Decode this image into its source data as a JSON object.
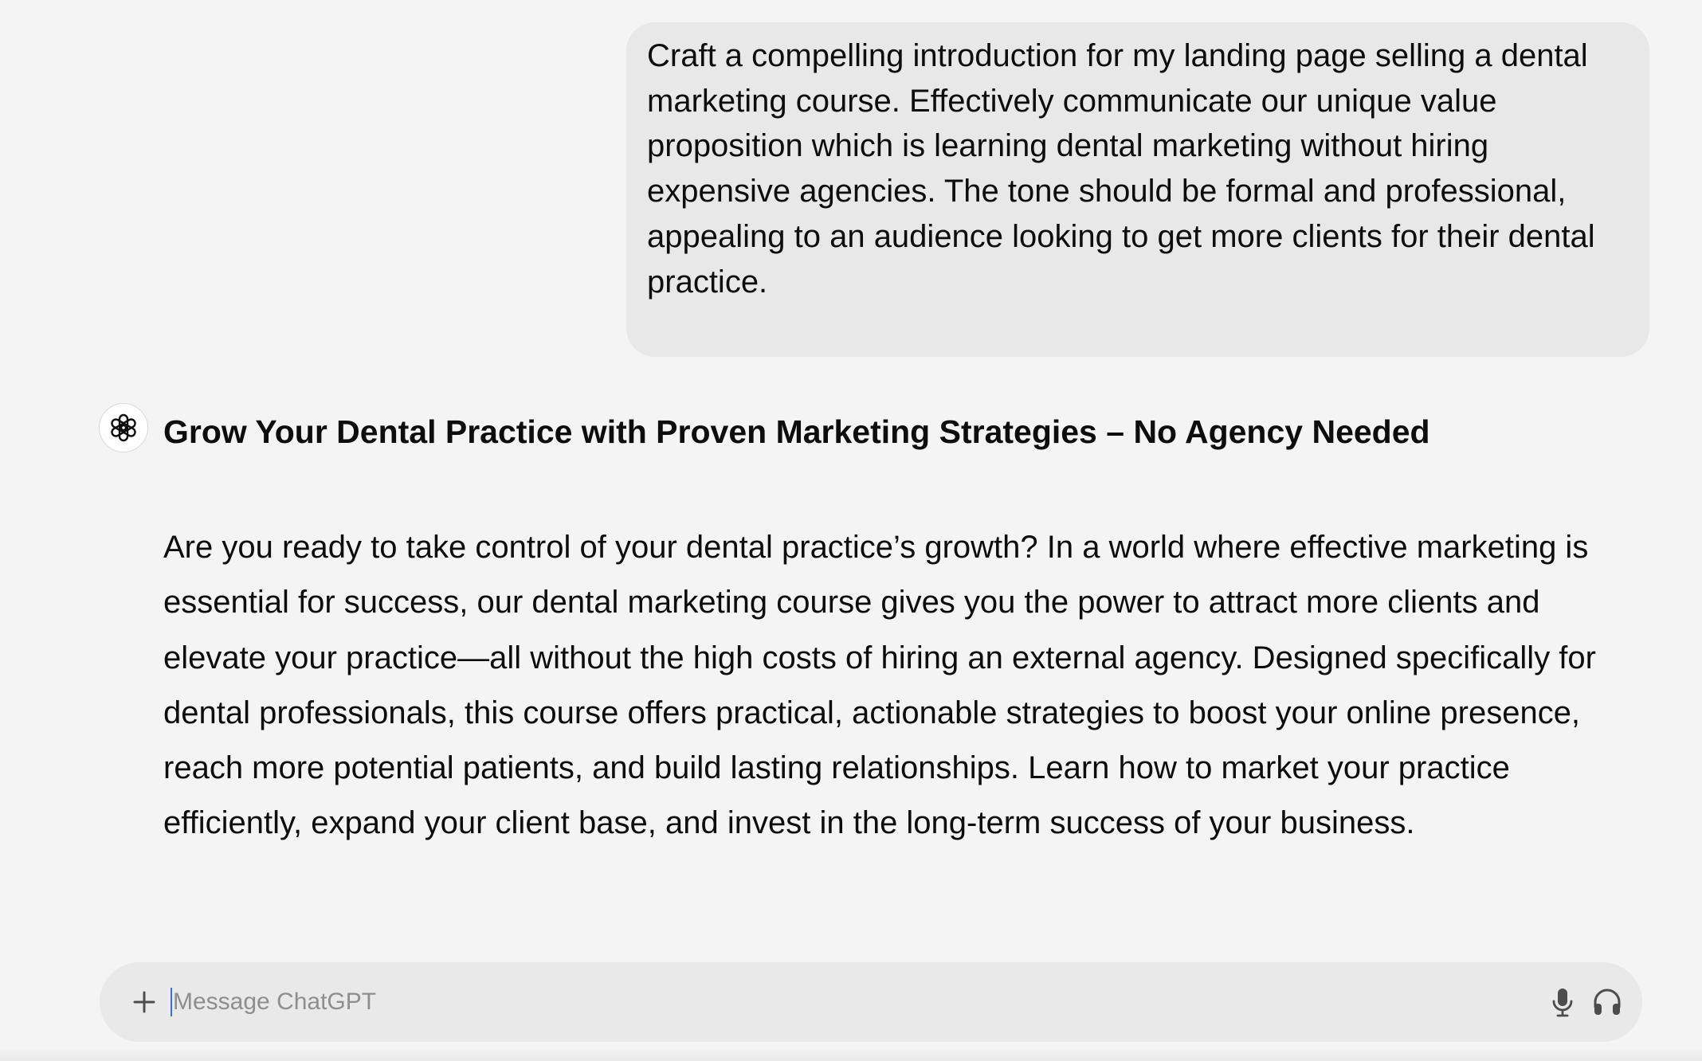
{
  "conversation": {
    "user_message": "Craft a compelling introduction for my landing page selling a dental marketing course. Effectively communicate our unique value proposition which is learning dental marketing without hiring expensive agencies. The tone should be formal and professional, appealing to an audience looking to get more clients for their dental practice.",
    "assistant": {
      "avatar_icon": "openai-logo-icon",
      "title": "Grow Your Dental Practice with Proven Marketing Strategies – No Agency Needed",
      "body": "Are you ready to take control of your dental practice’s growth? In a world where effective marketing is essential for success, our dental marketing course gives you the power to attract more clients and elevate your practice—all without the high costs of hiring an external agency. Designed specifically for dental professionals, this course offers practical, actionable strategies to boost your online presence, reach more potential patients, and build lasting relationships. Learn how to market your practice efficiently, expand your client base, and invest in the long-term success of your business."
    }
  },
  "composer": {
    "placeholder": "Message ChatGPT",
    "value": "",
    "icons": {
      "attach": "plus-icon",
      "voice_input": "microphone-icon",
      "voice_mode": "headphones-icon"
    }
  },
  "colors": {
    "background": "#f4f4f4",
    "user_bubble": "#e8e8e8",
    "composer": "#e9e9e9",
    "text": "#0d0d0d",
    "placeholder": "#8e8e8e",
    "caret": "#3b6fd8"
  }
}
